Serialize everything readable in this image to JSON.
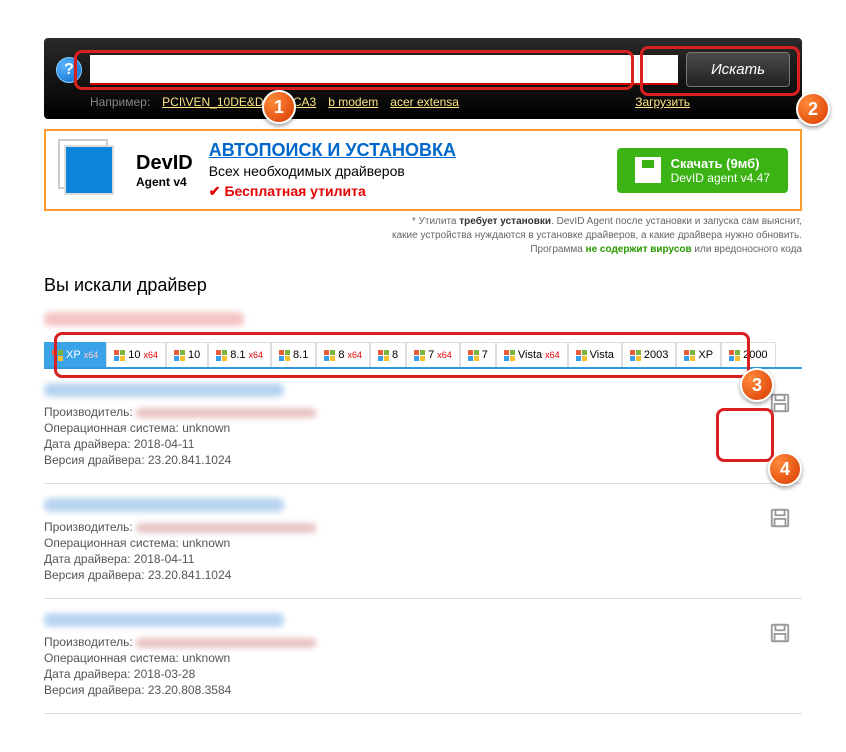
{
  "search": {
    "button_label": "Искать",
    "example_label": "Например:",
    "examples": [
      "PCI\\VEN_10DE&DEV_0CA3",
      "b modem",
      "acer extensa"
    ],
    "load_label": "Загрузить"
  },
  "promo": {
    "brand": "DevID",
    "version": "Agent v4",
    "headline": "АВТОПОИСК И УСТАНОВКА",
    "subline": "Всех необходимых драйверов",
    "free": "Бесплатная утилита",
    "download_line1": "Скачать (9мб)",
    "download_line2": "DevID agent v4.47"
  },
  "disclaimer": {
    "line1_a": "* Утилита ",
    "line1_b": "требует установки",
    "line1_c": ". DevID Agent после установки и запуска сам выяснит,",
    "line2": "какие устройства нуждаются в установке драйверов, а какие драйвера нужно обновить.",
    "line3_a": "Программа ",
    "line3_b": "не содержит вирусов",
    "line3_c": " или вредоносного кода"
  },
  "section_title": "Вы искали драйвер",
  "os_tabs": [
    {
      "label": "XP",
      "x64": true,
      "active": true
    },
    {
      "label": "10",
      "x64": true
    },
    {
      "label": "10"
    },
    {
      "label": "8.1",
      "x64": true
    },
    {
      "label": "8.1"
    },
    {
      "label": "8",
      "x64": true
    },
    {
      "label": "8"
    },
    {
      "label": "7",
      "x64": true
    },
    {
      "label": "7"
    },
    {
      "label": "Vista",
      "x64": true
    },
    {
      "label": "Vista"
    },
    {
      "label": "2003"
    },
    {
      "label": "XP"
    },
    {
      "label": "2000"
    }
  ],
  "labels": {
    "manufacturer": "Производитель:",
    "os": "Операционная система:",
    "date": "Дата драйвера:",
    "version": "Версия драйвера:"
  },
  "results": [
    {
      "os": "unknown",
      "date": "2018-04-11",
      "version": "23.20.841.1024"
    },
    {
      "os": "unknown",
      "date": "2018-04-11",
      "version": "23.20.841.1024"
    },
    {
      "os": "unknown",
      "date": "2018-03-28",
      "version": "23.20.808.3584"
    }
  ],
  "markers": [
    "1",
    "2",
    "3",
    "4"
  ]
}
